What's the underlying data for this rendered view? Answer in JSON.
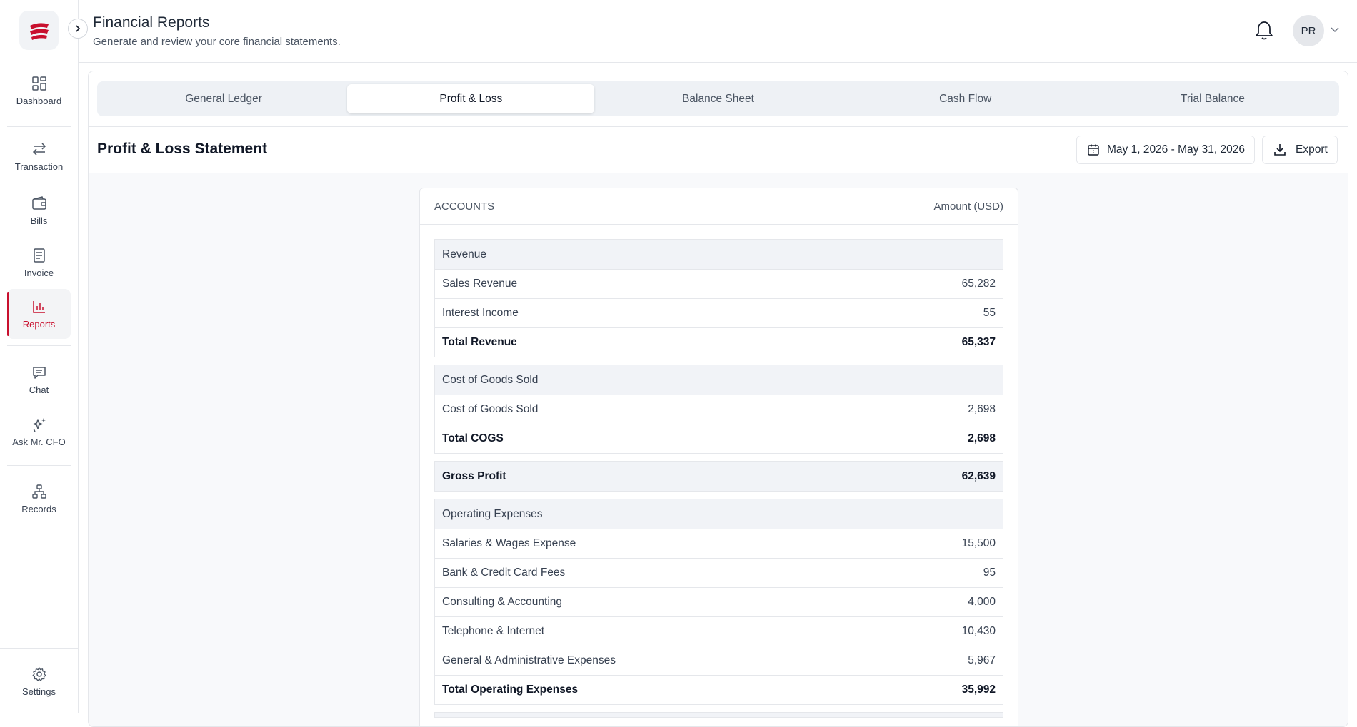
{
  "sidebar": {
    "items": [
      {
        "label": "Dashboard",
        "icon": "grid-icon"
      },
      {
        "label": "Transaction",
        "icon": "arrows-swap-icon"
      },
      {
        "label": "Bills",
        "icon": "wallet-icon"
      },
      {
        "label": "Invoice",
        "icon": "document-icon"
      },
      {
        "label": "Reports",
        "icon": "bar-chart-icon",
        "active": true
      },
      {
        "label": "Chat",
        "icon": "chat-icon"
      },
      {
        "label": "Ask Mr. CFO",
        "icon": "sparkles-icon"
      },
      {
        "label": "Records",
        "icon": "hierarchy-icon"
      },
      {
        "label": "Settings",
        "icon": "gear-icon"
      }
    ]
  },
  "header": {
    "title": "Financial Reports",
    "subtitle": "Generate and review your core financial statements.",
    "avatar_initials": "PR"
  },
  "tabs": [
    {
      "label": "General Ledger"
    },
    {
      "label": "Profit & Loss",
      "active": true
    },
    {
      "label": "Balance Sheet"
    },
    {
      "label": "Cash Flow"
    },
    {
      "label": "Trial Balance"
    }
  ],
  "statement": {
    "title": "Profit & Loss Statement",
    "date_range": "May 1, 2026 - May 31, 2026",
    "export_label": "Export"
  },
  "report": {
    "col_accounts": "ACCOUNTS",
    "col_amount": "Amount (USD)",
    "revenue": {
      "heading": "Revenue",
      "rows": [
        {
          "name": "Sales Revenue",
          "amount": "65,282"
        },
        {
          "name": "Interest Income",
          "amount": "55"
        }
      ],
      "total": {
        "name": "Total Revenue",
        "amount": "65,337"
      }
    },
    "cogs": {
      "heading": "Cost of Goods Sold",
      "rows": [
        {
          "name": "Cost of Goods Sold",
          "amount": "2,698"
        }
      ],
      "total": {
        "name": "Total COGS",
        "amount": "2,698"
      }
    },
    "gross_profit": {
      "name": "Gross Profit",
      "amount": "62,639"
    },
    "opex": {
      "heading": "Operating Expenses",
      "rows": [
        {
          "name": "Salaries & Wages Expense",
          "amount": "15,500"
        },
        {
          "name": "Bank & Credit Card Fees",
          "amount": "95"
        },
        {
          "name": "Consulting & Accounting",
          "amount": "4,000"
        },
        {
          "name": "Telephone & Internet",
          "amount": "10,430"
        },
        {
          "name": "General & Administrative Expenses",
          "amount": "5,967"
        }
      ],
      "total": {
        "name": "Total Operating Expenses",
        "amount": "35,992"
      }
    }
  },
  "colors": {
    "accent": "#c8102e",
    "border": "#e5e7eb",
    "section_header_bg": "#f1f3f7"
  }
}
